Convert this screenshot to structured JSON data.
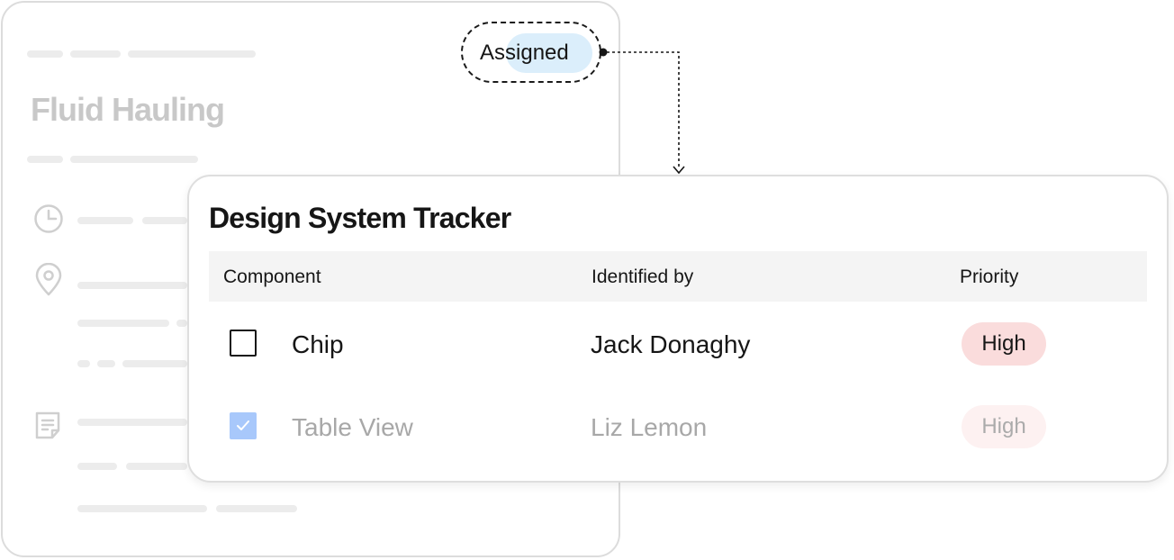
{
  "background_card": {
    "title": "Fluid Hauling",
    "icons": [
      "clock-icon",
      "location-pin-icon",
      "note-icon"
    ]
  },
  "chip": {
    "label": "Assigned"
  },
  "tracker": {
    "title": "Design System Tracker",
    "columns": [
      "Component",
      "Identified by",
      "Priority"
    ],
    "rows": [
      {
        "checked": false,
        "component": "Chip",
        "identified_by": "Jack Donaghy",
        "priority": "High"
      },
      {
        "checked": true,
        "component": "Table View",
        "identified_by": "Liz Lemon",
        "priority": "High"
      }
    ]
  },
  "colors": {
    "chip_bg": "#dbeefb",
    "high_priority_bg": "#fadcdc",
    "checkbox_checked": "#a8c8fb",
    "header_bg": "#f4f4f4"
  }
}
